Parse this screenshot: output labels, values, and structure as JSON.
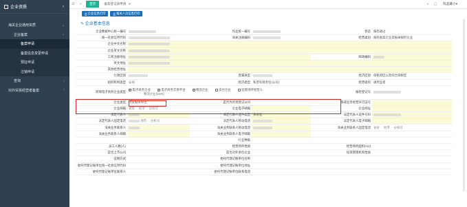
{
  "sidebar": {
    "title": "企业资质",
    "items": [
      {
        "label": "海关企业通用资质",
        "level": 1,
        "arrow": "⌄"
      },
      {
        "label": "企业备案",
        "level": 2,
        "arrow": "⌄"
      },
      {
        "label": "备案申请",
        "level": 3,
        "active": true
      },
      {
        "label": "备案信息变更申请",
        "level": 3
      },
      {
        "label": "预征申请",
        "level": 3
      },
      {
        "label": "注销申请",
        "level": 3
      },
      {
        "label": "查询",
        "level": 2,
        "arrow": "‹"
      },
      {
        "label": "对外贸易经营者备案",
        "level": 1,
        "arrow": "‹"
      }
    ]
  },
  "topbar": {
    "tabs": [
      {
        "label": "首页",
        "active": true
      },
      {
        "label": "备案登记表申请",
        "active": false
      }
    ],
    "user": "陈品藏小▾"
  },
  "buttons": [
    "企业信息打印",
    "报关人员信息打印"
  ],
  "section_title": "企业基本信息",
  "form": {
    "r1": [
      "企业数据中心统一编号",
      "",
      "作业统一编号",
      "",
      "状态",
      "报检通过"
    ],
    "r2": [
      "统一社会信用代码",
      "",
      "海关注册编码",
      "",
      "经营类别",
      "报检备案企业及报关报检企业"
    ],
    "r3": [
      "企业中文名称"
    ],
    "r4": [
      "企业英文名称"
    ],
    "r5": [
      "工商注册地址",
      "",
      "",
      "",
      "邮政编码",
      ""
    ],
    "r6": [
      "英文地址"
    ],
    "r7": [
      "其他经营地址"
    ],
    "r8": [
      "行政区划",
      "",
      "直属关区",
      "",
      "经济区划",
      "保税港区以及综合保税区"
    ],
    "r9": [
      "组织机构类型",
      "公司",
      "经济类型",
      "私营有限责任(公司)",
      "经营类别",
      "通用业者"
    ],
    "r10": {
      "label": "跨境电子商务企业类型",
      "options": [
        {
          "label": "电子商务企业",
          "checked": true
        },
        {
          "label": "电子商务交易平台",
          "checked": true
        },
        {
          "label": "物流企业",
          "checked": true
        },
        {
          "label": "支付企业",
          "checked": false
        },
        {
          "label": "监管场所经营人",
          "checked": false
        }
      ],
      "note": "物流企业(EMS)",
      "extra_label": "报检登记号"
    },
    "r11": [
      "企业类型",
      "内资股份单位",
      "是否为外资登记公司",
      "",
      "快递业务经营许可证号",
      ""
    ],
    "r12": [
      "企业邮箱",
      "",
      "企业电子邮箱",
      "",
      "企业网址",
      ""
    ],
    "r13": [
      "法定代表人",
      "",
      "法定代表人证件类型",
      "身份证",
      "法定代表人证件号码",
      ""
    ],
    "r14": [
      "法定代表人固定电话",
      "",
      "法定代表人移动电话",
      "",
      "法定代表人电子邮箱",
      ""
    ],
    "r15": [
      "海关业务联系人",
      "",
      "海关业务联系人移动电话",
      "",
      "海关业务联系人固定电话",
      ""
    ],
    "r16": [
      "海关业务联系人邮箱",
      "",
      "海关业务联系人电子邮箱",
      "",
      "",
      ""
    ],
    "r17": [
      "",
      "",
      "行业种类",
      "",
      "",
      ""
    ],
    "r18": [
      "员工人数(人)",
      "",
      "经营场所性质",
      "",
      "经营场所面积(m2)",
      ""
    ],
    "r19": [
      "是否上市公司",
      "",
      "是否对外承包企业",
      "",
      "投资管理机构性质",
      ""
    ],
    "r20": [
      "征税方式",
      "",
      "委托代理记账单位名称",
      "",
      "",
      ""
    ],
    "r21": [
      "委托代理记账单位统一社会信用代码",
      "",
      "委托代理记账单位地址",
      "",
      "",
      ""
    ],
    "r22": [
      "委托代理记账单位联系人",
      "",
      "委托代理记账单位联系电话",
      "",
      "",
      ""
    ],
    "select_province": "省份",
    "select_city": "地市",
    "select_district": "分机号"
  }
}
